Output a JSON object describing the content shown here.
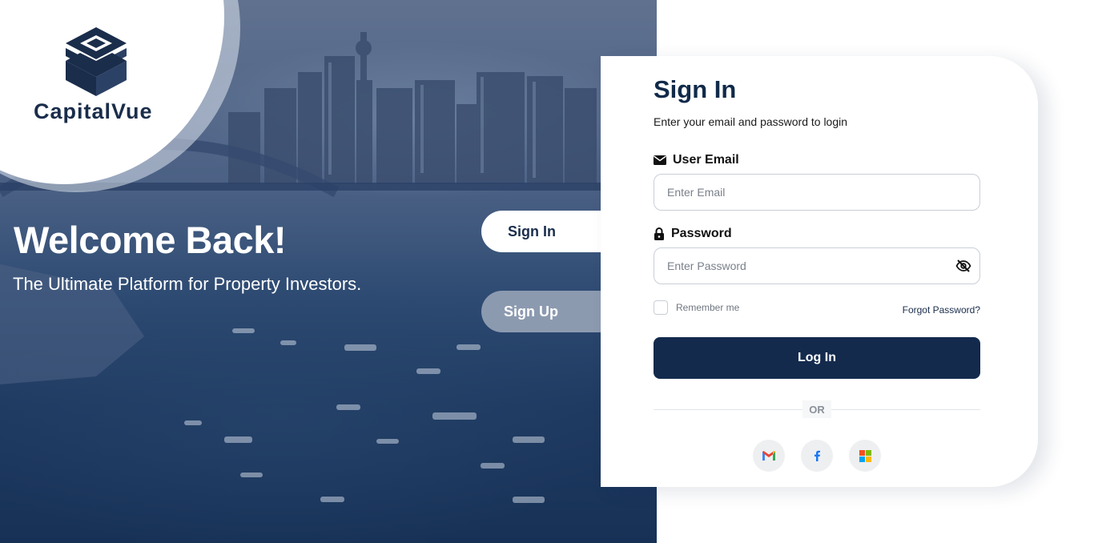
{
  "brand": {
    "name": "CapitalVue",
    "colors": {
      "primary": "#132a4d",
      "accent": "#8c9ab0"
    }
  },
  "hero": {
    "headline": "Welcome Back!",
    "tagline": "The Ultimate Platform for Property Investors."
  },
  "tabs": {
    "signin": "Sign In",
    "signup": "Sign Up"
  },
  "form": {
    "title": "Sign In",
    "subtitle": "Enter your email and password to login",
    "email_label": "User Email",
    "email_placeholder": "Enter Email",
    "email_icon": "envelope-icon",
    "password_label": "Password",
    "password_placeholder": "Enter Password",
    "password_icon": "lock-icon",
    "toggle_icon": "eye-slash-icon",
    "remember_label": "Remember me",
    "forgot_label": "Forgot Password?",
    "login_label": "Log In",
    "or_label": "OR"
  },
  "social": [
    {
      "icon": "gmail-icon"
    },
    {
      "icon": "facebook-icon"
    },
    {
      "icon": "microsoft-icon"
    }
  ]
}
